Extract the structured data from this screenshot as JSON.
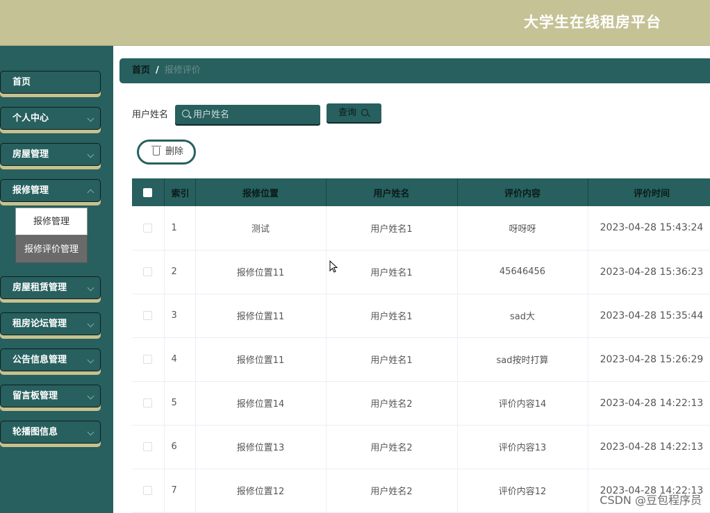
{
  "header": {
    "title": "大学生在线租房平台"
  },
  "sidebar": {
    "items": [
      {
        "label": "首页"
      },
      {
        "label": "个人中心"
      },
      {
        "label": "房屋管理"
      },
      {
        "label": "报修管理"
      },
      {
        "label": "房屋租赁管理"
      },
      {
        "label": "租房论坛管理"
      },
      {
        "label": "公告信息管理"
      },
      {
        "label": "留言板管理"
      },
      {
        "label": "轮播图信息"
      }
    ],
    "submenu": [
      {
        "label": "报修管理"
      },
      {
        "label": "报修评价管理"
      }
    ]
  },
  "breadcrumb": {
    "home": "首页",
    "separator": "/",
    "current": "报修评价"
  },
  "search": {
    "label": "用户姓名",
    "placeholder": "用户姓名",
    "query_button": "查询"
  },
  "toolbar": {
    "delete_label": "删除"
  },
  "table": {
    "headers": [
      "索引",
      "报修位置",
      "用户姓名",
      "评价内容",
      "评价时间"
    ],
    "rows": [
      [
        "1",
        "测试",
        "用户姓名1",
        "呀呀呀",
        "2023-04-28 15:43:24"
      ],
      [
        "2",
        "报修位置11",
        "用户姓名1",
        "45646456",
        "2023-04-28 15:36:23"
      ],
      [
        "3",
        "报修位置11",
        "用户姓名1",
        "sad大",
        "2023-04-28 15:35:44"
      ],
      [
        "4",
        "报修位置11",
        "用户姓名1",
        "sad按时打算",
        "2023-04-28 15:26:29"
      ],
      [
        "5",
        "报修位置14",
        "用户姓名2",
        "评价内容14",
        "2023-04-28 14:22:13"
      ],
      [
        "6",
        "报修位置13",
        "用户姓名2",
        "评价内容13",
        "2023-04-28 14:22:13"
      ],
      [
        "7",
        "报修位置12",
        "用户姓名2",
        "评价内容12",
        "2023-04-28 14:22:13"
      ]
    ]
  },
  "watermark": "CSDN @豆包程序员"
}
